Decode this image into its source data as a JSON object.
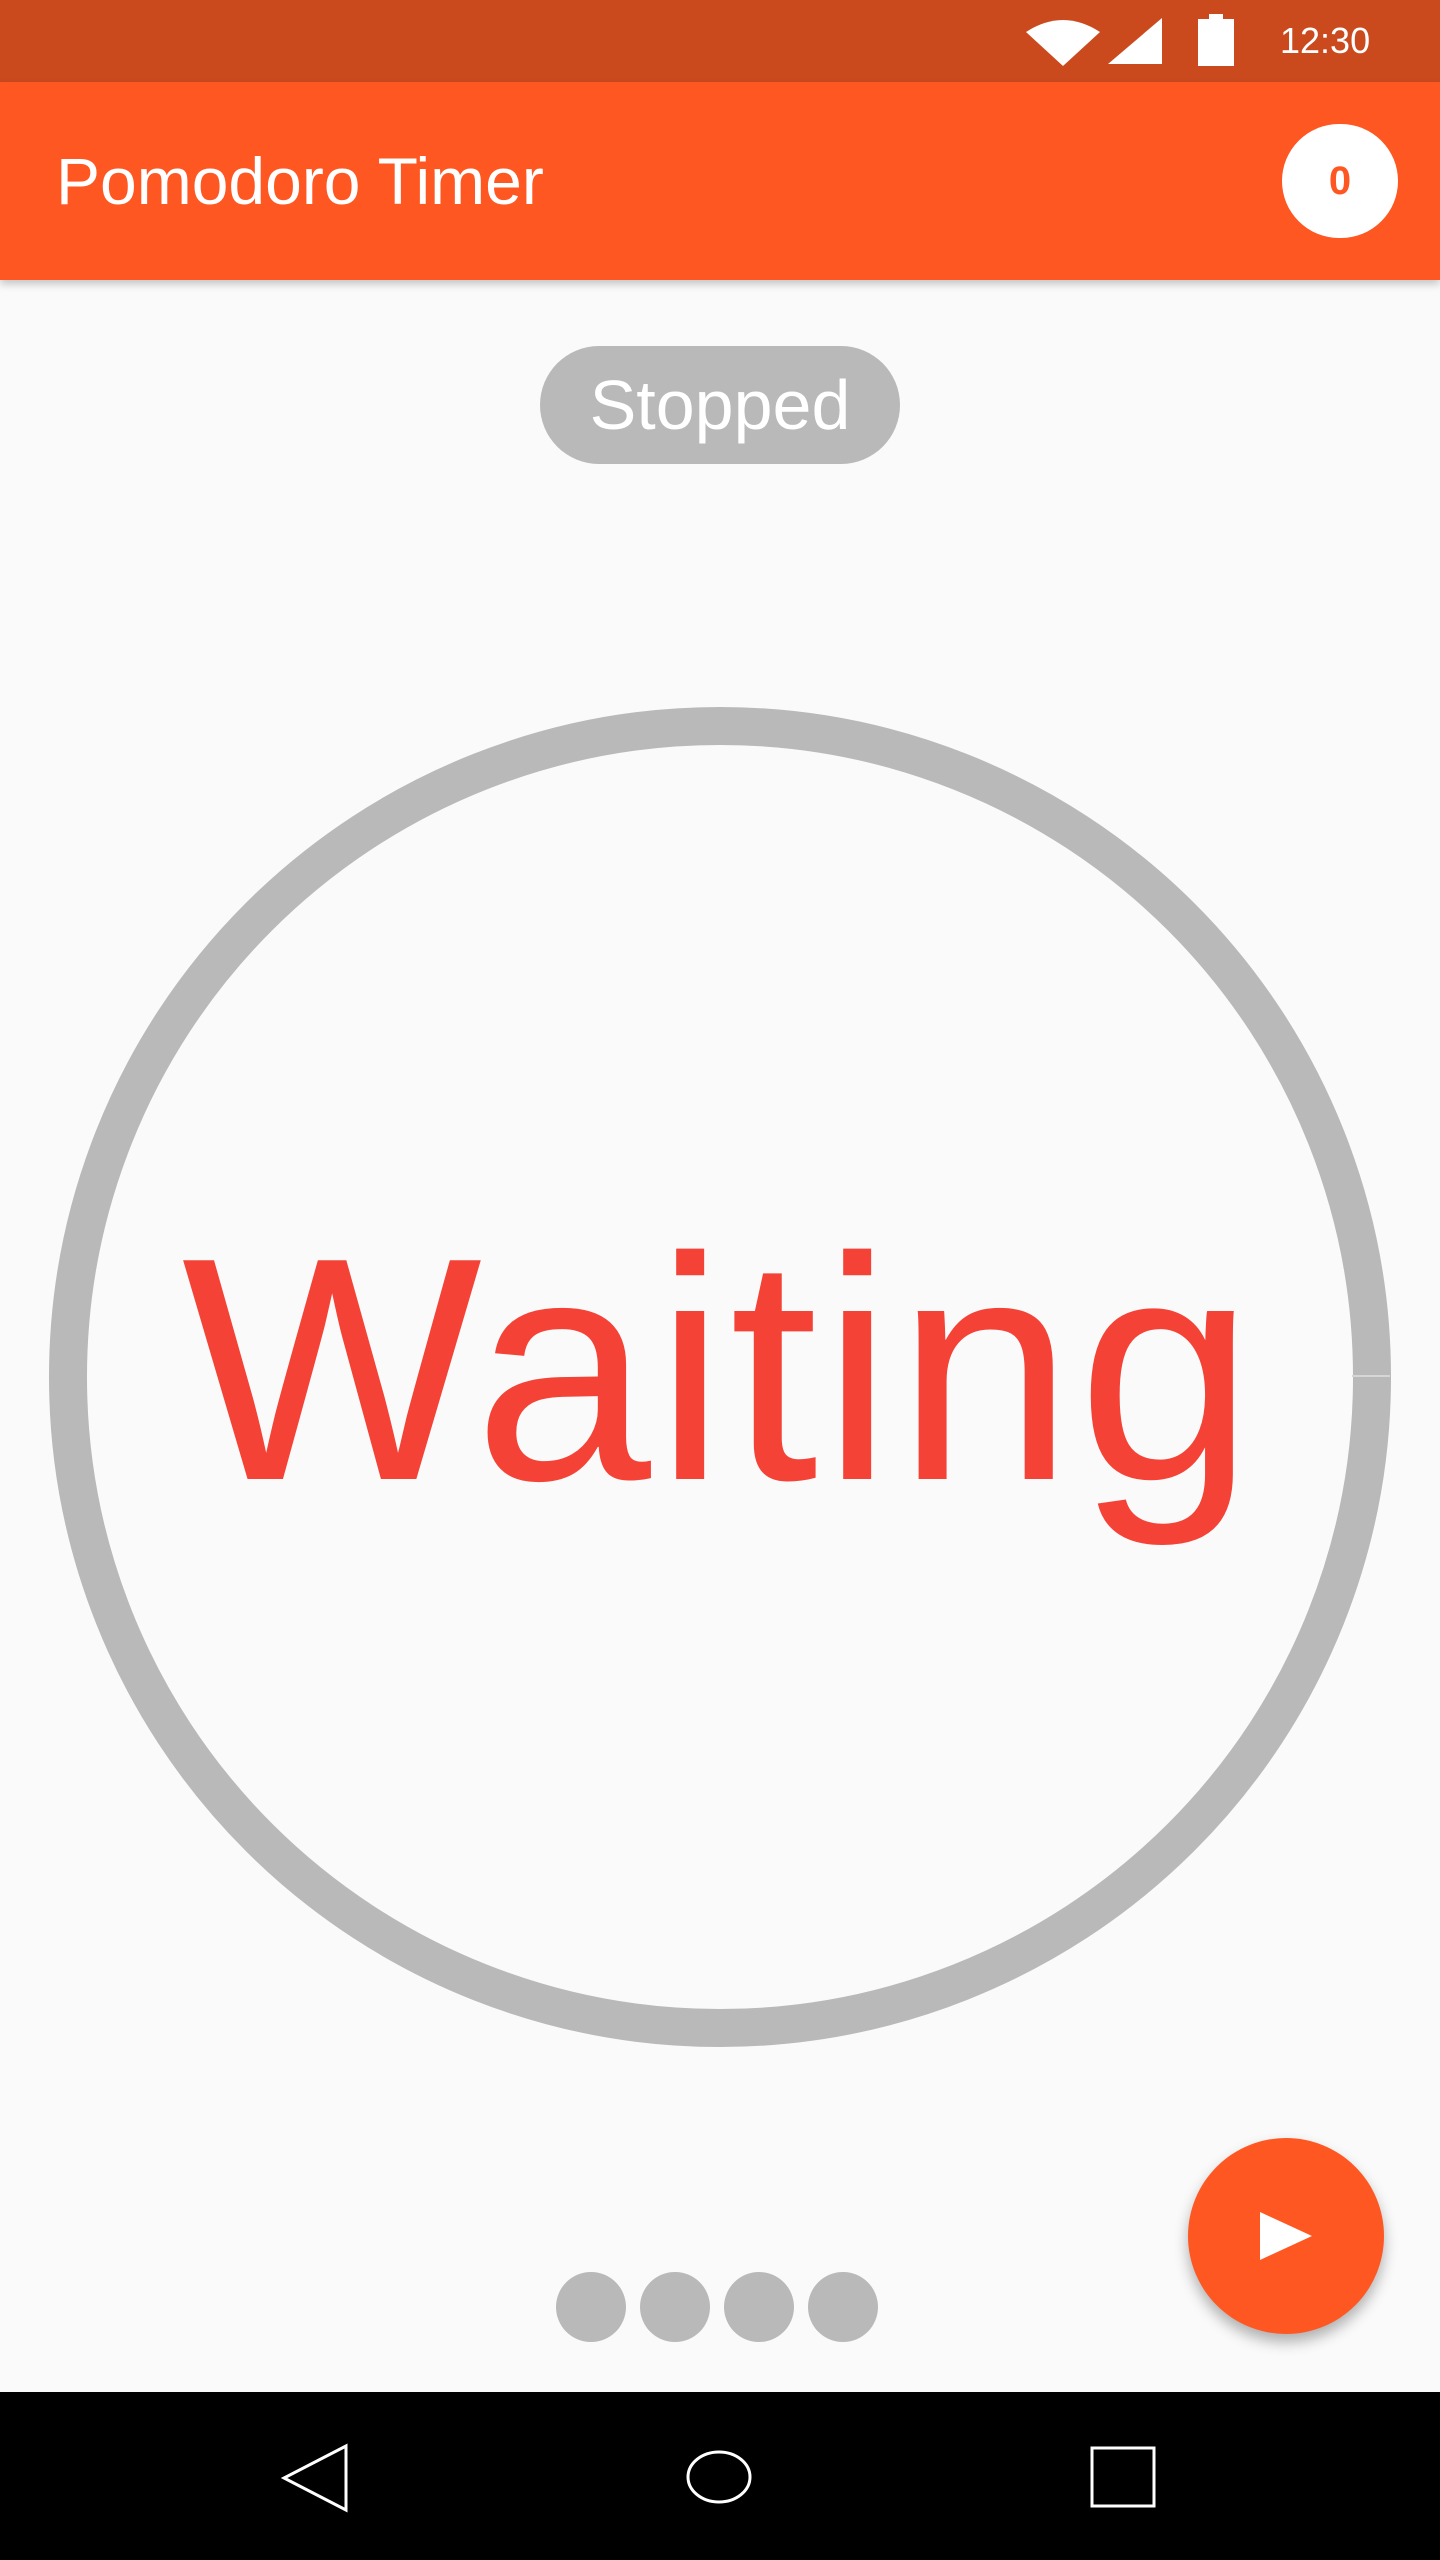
{
  "status_bar": {
    "time": "12:30",
    "icons": [
      "wifi-icon",
      "cell-signal-icon",
      "battery-icon"
    ]
  },
  "app_bar": {
    "title": "Pomodoro Timer",
    "counter": "0"
  },
  "timer": {
    "state_label": "Stopped",
    "display_text": "Waiting",
    "progress_fraction": 0
  },
  "page_indicator": {
    "count": 4
  },
  "fab": {
    "icon": "play-icon"
  },
  "nav_bar": {
    "icons": [
      "back-icon",
      "home-icon",
      "recents-icon"
    ]
  },
  "colors": {
    "accent": "#ff5722",
    "status_bar": "#ca4a1e",
    "timer_text": "#f44336",
    "neutral_gray": "#b9b9b9",
    "background": "#fafafa"
  }
}
